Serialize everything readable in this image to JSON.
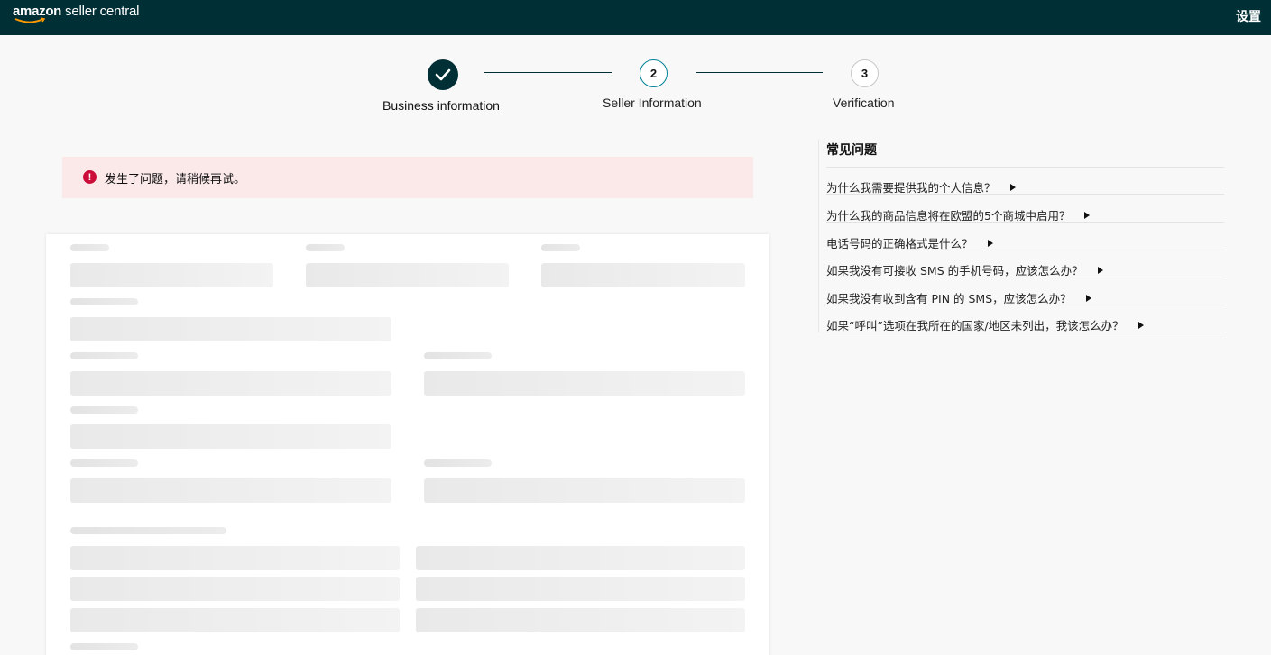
{
  "header": {
    "logo_brand": "amazon",
    "logo_rest": " seller central",
    "settings_label": "设置",
    "background_color": "#002f36"
  },
  "stepper": {
    "steps": [
      {
        "number": "",
        "label": "Business information",
        "state": "completed",
        "icon": "checkmark-icon"
      },
      {
        "number": "2",
        "label": "Seller Information",
        "state": "current"
      },
      {
        "number": "3",
        "label": "Verification",
        "state": "upcoming"
      }
    ],
    "active_color": "#008296"
  },
  "alert": {
    "icon": "error-icon",
    "icon_glyph": "!",
    "message": "发生了问题，请稍候再试。",
    "background_color": "#fbe9ea",
    "icon_color": "#cc0c39"
  },
  "form": {
    "state": "loading-skeleton"
  },
  "faq": {
    "title": "常见问题",
    "items": [
      "为什么我需要提供我的个人信息？",
      "为什么我的商品信息将在欧盟的5个商城中启用？",
      "电话号码的正确格式是什么？",
      "如果我没有可接收 SMS 的手机号码，应该怎么办？",
      "如果我没有收到含有 PIN 的 SMS，应该怎么办？",
      "如果“呼叫”选项在我所在的国家/地区未列出，我该怎么办？"
    ]
  }
}
